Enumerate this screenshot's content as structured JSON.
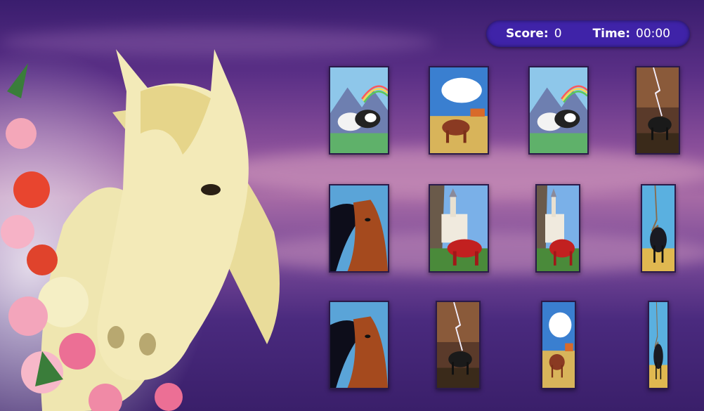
{
  "hud": {
    "score_label": "Score:",
    "score_value": "0",
    "time_label": "Time:",
    "time_value": "00:00"
  },
  "cards": [
    {
      "row": 1,
      "col": 1,
      "scene": "horses-mountain-rainbow"
    },
    {
      "row": 1,
      "col": 2,
      "scene": "horse-sky-field"
    },
    {
      "row": 1,
      "col": 3,
      "scene": "horses-mountain-rainbow"
    },
    {
      "row": 1,
      "col": 4,
      "scene": "horse-lightning"
    },
    {
      "row": 2,
      "col": 1,
      "scene": "horse-head-wind"
    },
    {
      "row": 2,
      "col": 2,
      "scene": "horse-castle"
    },
    {
      "row": 2,
      "col": 3,
      "scene": "horse-castle"
    },
    {
      "row": 2,
      "col": 4,
      "scene": "horse-tree"
    },
    {
      "row": 3,
      "col": 1,
      "scene": "horse-head-wind"
    },
    {
      "row": 3,
      "col": 2,
      "scene": "horse-lightning"
    },
    {
      "row": 3,
      "col": 3,
      "scene": "horse-sky-field"
    },
    {
      "row": 3,
      "col": 4,
      "scene": "horse-tree"
    }
  ],
  "colors": {
    "hud_bg": "#3f23a8",
    "bg_top": "#3a1d6e",
    "bg_mid": "#a66aa5"
  }
}
